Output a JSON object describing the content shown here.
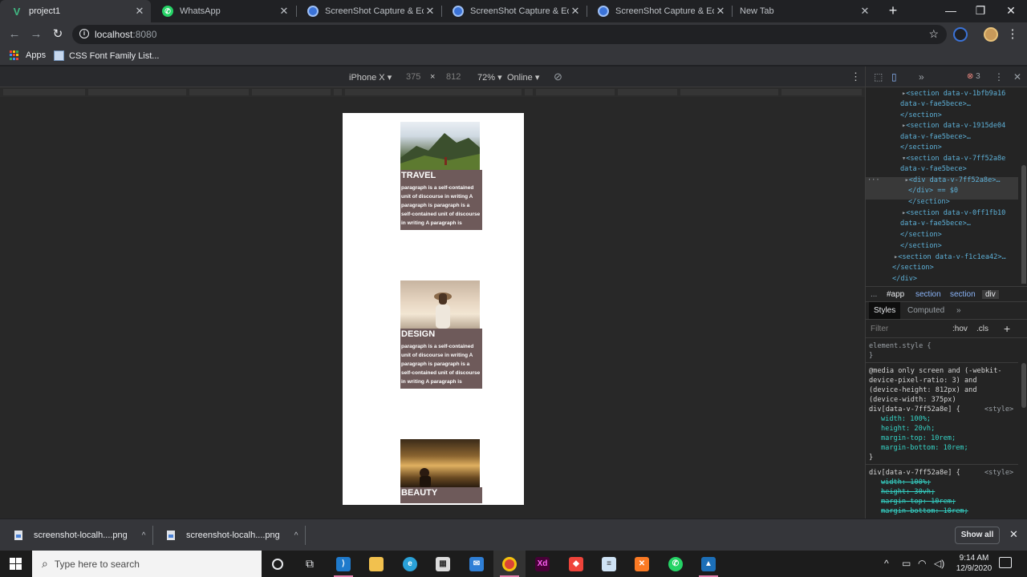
{
  "browser": {
    "tabs": [
      {
        "title": "project1",
        "active": true,
        "favicon": "vue-icon"
      },
      {
        "title": "WhatsApp",
        "active": false,
        "favicon": "whatsapp-icon"
      },
      {
        "title": "ScreenShot Capture & Editor",
        "active": false,
        "favicon": "screenshot-extension-icon"
      },
      {
        "title": "ScreenShot Capture & Editor",
        "active": false,
        "favicon": "screenshot-extension-icon"
      },
      {
        "title": "ScreenShot Capture & Editor",
        "active": false,
        "favicon": "screenshot-extension-icon"
      },
      {
        "title": "New Tab",
        "active": false,
        "favicon": ""
      }
    ],
    "url_host": "localhost",
    "url_port": ":8080",
    "bookmarks": [
      {
        "label": "Apps",
        "icon": "apps-grid-icon"
      },
      {
        "label": "CSS Font Family List...",
        "icon": "bookmark-page-icon"
      }
    ]
  },
  "device_toolbar": {
    "device": "iPhone X",
    "width": "375",
    "times": "×",
    "height": "812",
    "zoom": "72%",
    "network": "Online"
  },
  "page": {
    "cards": [
      {
        "heading": "TRAVEL",
        "text": "paragraph is a self-contained unit of discourse in writing A paragraph is paragraph is a self-contained unit of discourse in writing A paragraph is"
      },
      {
        "heading": "DESIGN",
        "text": "paragraph is a self-contained unit of discourse in writing A paragraph is paragraph is a self-contained unit of discourse in writing A paragraph is"
      },
      {
        "heading": "BEAUTY",
        "text": ""
      }
    ]
  },
  "devtools": {
    "error_count": "3",
    "dom_lines": [
      "<section data-v-1bfb9a16",
      "data-v-fae5bece>…",
      "</section>",
      "<section data-v-1915de04",
      "data-v-fae5bece>…",
      "</section>",
      "<section data-v-7ff52a8e",
      "data-v-fae5bece>",
      "<div data-v-7ff52a8e>…",
      "</div> == $0",
      "</section>",
      "<section data-v-0ff1fb10",
      "data-v-fae5bece>…",
      "</section>",
      "</section>",
      "<section data-v-f1c1ea42>…",
      "</section>",
      "</div>"
    ],
    "breadcrumbs": [
      "...",
      "#app",
      "section",
      "section",
      "div"
    ],
    "subtabs": [
      "Styles",
      "Computed",
      "»"
    ],
    "filter_placeholder": "Filter",
    "hov": ":hov",
    "cls": ".cls",
    "style_lines": [
      "element.style {",
      "}",
      "@media only screen and (-webkit-",
      "device-pixel-ratio: 3) and",
      "(device-height: 812px) and",
      "(device-width: 375px)",
      "div[data-v-7ff52a8e] {",
      "width: 100%;",
      "height: 20vh;",
      "margin-top: 10rem;",
      "margin-bottom: 10rem;",
      "}",
      "div[data-v-7ff52a8e] {",
      "width: 100%;",
      "height: 30vh;",
      "margin-top: 10rem;",
      "margin-bottom: 10rem;"
    ],
    "style_source": "<style>"
  },
  "downloads": {
    "items": [
      "screenshot-localh....png",
      "screenshot-localh....png"
    ],
    "show_all": "Show all"
  },
  "taskbar": {
    "search_placeholder": "Type here to search",
    "time": "9:14 AM",
    "date": "12/9/2020"
  }
}
